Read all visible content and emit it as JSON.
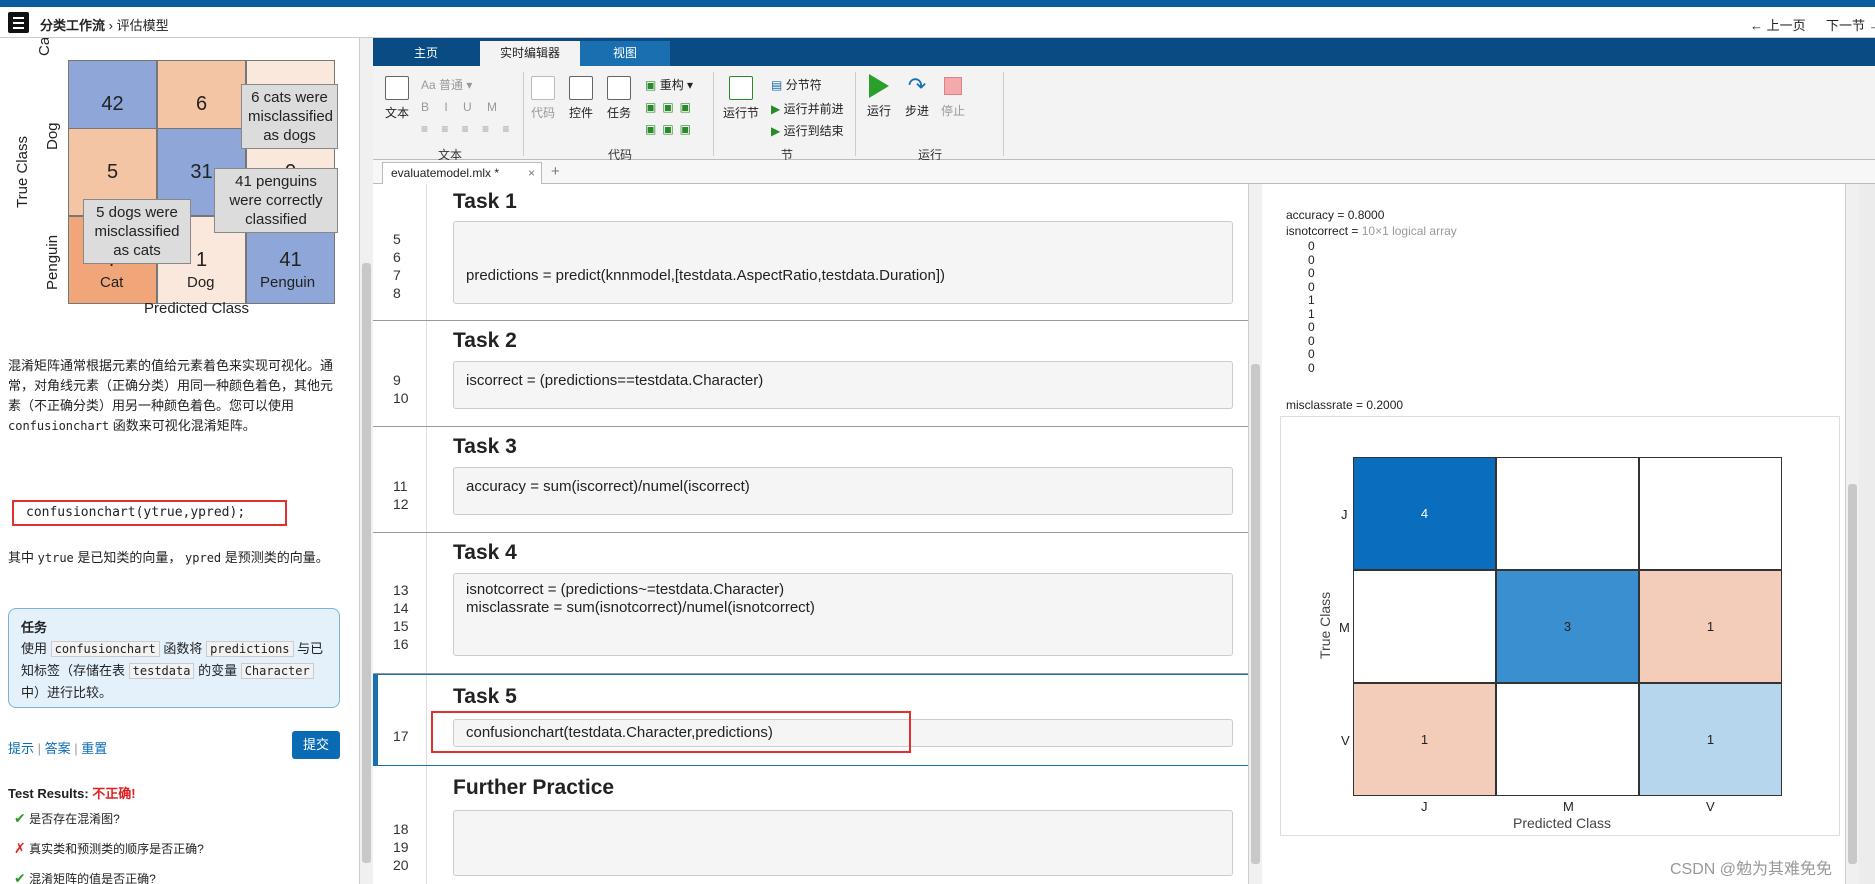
{
  "nav": {
    "breadcrumb_root": "分类工作流",
    "breadcrumb_sep": "›",
    "breadcrumb_current": "评估模型",
    "prev": "← 上一页",
    "next": "下一节 →"
  },
  "left": {
    "chart_data": {
      "type": "heatmap",
      "xlabel": "Predicted Class",
      "ylabel": "True Class",
      "x_categories": [
        "Cat",
        "Dog",
        "Penguin"
      ],
      "y_categories": [
        "Cat",
        "Dog",
        "Penguin"
      ],
      "values": [
        [
          "42",
          "6",
          "0"
        ],
        [
          "5",
          "31",
          "0"
        ],
        [
          "7",
          "1",
          "41"
        ]
      ],
      "annotations": [
        "6 cats were misclassified as dogs",
        "41 penguins were correctly classified",
        "5 dogs were misclassified as cats"
      ]
    },
    "y_tick_cut": "Ca",
    "para1": "混淆矩阵通常根据元素的值给元素着色来实现可视化。通常，对角线元素（正确分类）用同一种颜色着色，其他元素（不正确分类）用另一种颜色着色。您可以使用",
    "para1_code": "confusionchart",
    "para1_end": "函数来可视化混淆矩阵。",
    "code_example": "confusionchart(ytrue,ypred);",
    "para2_a": "其中",
    "para2_code1": "ytrue",
    "para2_b": "是已知类的向量，",
    "para2_code2": "ypred",
    "para2_c": "是预测类的向量。",
    "task_title": "任务",
    "task_a": "使用",
    "task_code1": "confusionchart",
    "task_b": "函数将",
    "task_code2": "predictions",
    "task_c": "与已知标签（存储在表",
    "task_code3": "testdata",
    "task_d": "的变量",
    "task_code4": "Character",
    "task_e": "中）进行比较。",
    "link_hint": "提示",
    "link_answer": "答案",
    "link_reset": "重置",
    "submit": "提交",
    "test_results_label": "Test Results:",
    "test_results_status": "不正确!",
    "tests": [
      {
        "mark": "✔",
        "text": "是否存在混淆图?"
      },
      {
        "mark": "✗",
        "text": "真实类和预测类的顺序是否正确?"
      },
      {
        "mark": "✔",
        "text": "混淆矩阵的值是否正确?"
      }
    ]
  },
  "tabs": [
    "主页",
    "实时编辑器",
    "视图"
  ],
  "ribbon": {
    "text_btn": "文本",
    "style_dd": "普通",
    "group_text": "文本",
    "code_btn": "代码",
    "control_btn": "控件",
    "task_btn": "任务",
    "refactor": "重构",
    "group_code": "代码",
    "run_section": "运行节",
    "section_break": "分节符",
    "run_advance": "运行并前进",
    "run_to_end": "运行到结束",
    "group_section": "节",
    "run": "运行",
    "step": "步进",
    "stop": "停止",
    "group_run": "运行"
  },
  "file_tab": "evaluatemodel.mlx *",
  "file_tab_close": "×",
  "file_tab_add": "+",
  "editor": {
    "sections": [
      {
        "title": "Task 1",
        "lines": [
          "5",
          "6",
          "7",
          "8"
        ],
        "code": [
          "",
          "",
          "predictions = predict(knnmodel,[testdata.AspectRatio,testdata.Duration])",
          ""
        ]
      },
      {
        "title": "Task 2",
        "lines": [
          "9",
          "10"
        ],
        "code": [
          "iscorrect = (predictions==testdata.Character)",
          ""
        ]
      },
      {
        "title": "Task 3",
        "lines": [
          "11",
          "12"
        ],
        "code": [
          "accuracy = sum(iscorrect)/numel(iscorrect)",
          ""
        ]
      },
      {
        "title": "Task 4",
        "lines": [
          "13",
          "14",
          "15",
          "16"
        ],
        "code": [
          "isnotcorrect = (predictions~=testdata.Character)",
          "misclassrate =  sum(isnotcorrect)/numel(isnotcorrect)",
          "",
          ""
        ]
      },
      {
        "title": "Task 5",
        "lines": [
          "17"
        ],
        "code": [
          "confusionchart(testdata.Character,predictions)"
        ]
      },
      {
        "title": "Further Practice",
        "lines": [
          "18",
          "19",
          "20"
        ],
        "code": [
          "",
          "",
          ""
        ]
      }
    ]
  },
  "output": {
    "accuracy": "accuracy = 0.8000",
    "isnotcorrect_label": "isnotcorrect =",
    "isnotcorrect_type": "10×1 logical array",
    "isnotcorrect_values": [
      "0",
      "0",
      "0",
      "0",
      "1",
      "1",
      "0",
      "0",
      "0",
      "0"
    ],
    "misclassrate": "misclassrate = 0.2000",
    "chart_data": {
      "type": "heatmap",
      "xlabel": "Predicted Class",
      "ylabel": "True Class",
      "x_categories": [
        "J",
        "M",
        "V"
      ],
      "y_categories": [
        "J",
        "M",
        "V"
      ],
      "values": [
        [
          "4",
          "",
          ""
        ],
        [
          "",
          "3",
          "1"
        ],
        [
          "1",
          "",
          "1"
        ]
      ]
    }
  },
  "watermark": "CSDN @勉为其难免免"
}
